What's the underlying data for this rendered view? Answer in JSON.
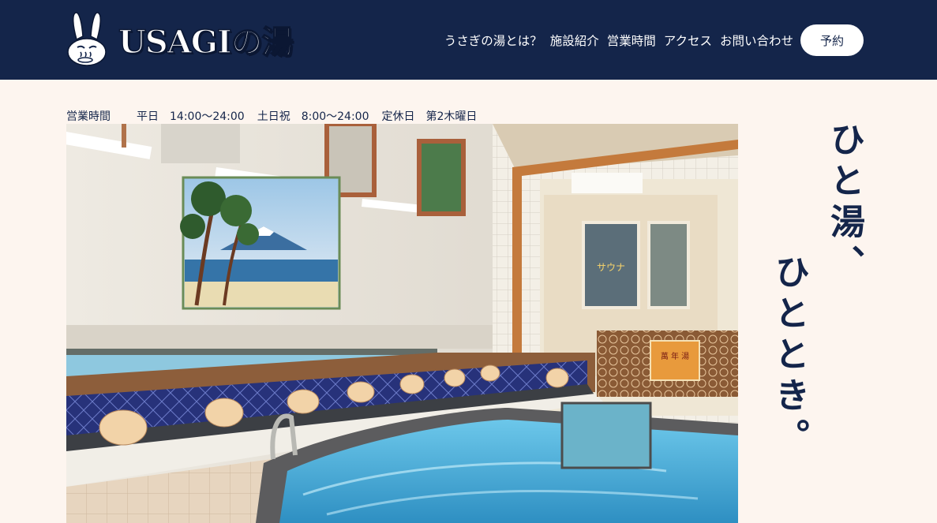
{
  "header": {
    "logo_text": "USAGIの湯",
    "nav": [
      "うさぎの湯とは？",
      "施設紹介",
      "営業時間",
      "アクセス",
      "お問い合わせ"
    ],
    "reserve_label": "予約"
  },
  "hours": {
    "label": "営業時間",
    "weekday": "平日　14:00～24:00",
    "weekend": "土日祝　8:00～24:00",
    "closed": "定休日　第2木曜日"
  },
  "tagline": {
    "line1": "ひと湯、",
    "line2": "ひととき。"
  },
  "colors": {
    "navy": "#14254a",
    "cream": "#fdf5ef"
  }
}
